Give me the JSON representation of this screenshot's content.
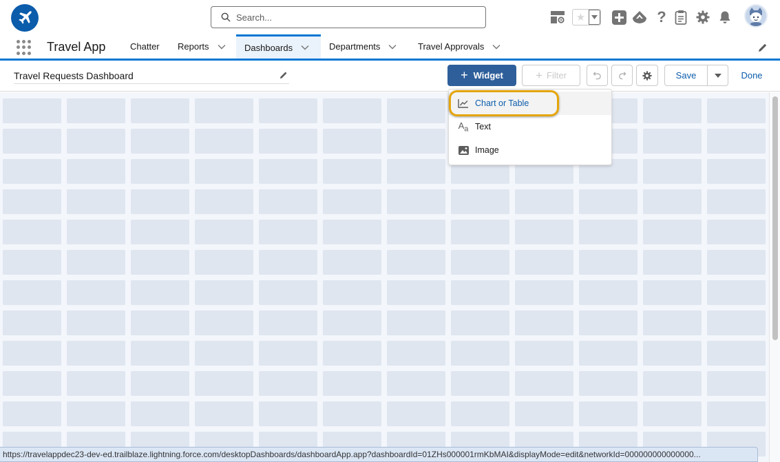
{
  "global_header": {
    "logo_icon": "airplane-icon",
    "search": {
      "placeholder": "Search...",
      "value": ""
    },
    "icons": [
      "setup-assistant-icon",
      "favorite-star-icon",
      "favorites-dropdown-icon",
      "global-actions-plus-icon",
      "trailhead-icon",
      "help-icon",
      "clipboard-icon",
      "setup-gear-icon",
      "notifications-bell-icon",
      "user-avatar-icon"
    ]
  },
  "nav": {
    "app_name": "Travel App",
    "items": [
      {
        "label": "Chatter",
        "has_menu": false,
        "active": false
      },
      {
        "label": "Reports",
        "has_menu": true,
        "active": false
      },
      {
        "label": "Dashboards",
        "has_menu": true,
        "active": true
      },
      {
        "label": "Departments",
        "has_menu": true,
        "active": false
      },
      {
        "label": "Travel Approvals",
        "has_menu": true,
        "active": false
      }
    ],
    "accent_color": "#0176d3"
  },
  "toolbar": {
    "dashboard_title": "Travel Requests Dashboard",
    "widget_label": "Widget",
    "filter_label": "Filter",
    "save_label": "Save",
    "done_label": "Done",
    "primary_color": "#2e5f9a"
  },
  "widget_menu": {
    "items": [
      {
        "label": "Chart or Table",
        "icon": "line-chart-icon",
        "highlighted": true
      },
      {
        "label": "Text",
        "icon": "text-format-icon",
        "highlighted": false
      },
      {
        "label": "Image",
        "icon": "image-icon",
        "highlighted": false
      }
    ],
    "highlight_color": "#e5a50a"
  },
  "canvas": {
    "columns": 12,
    "rows": 12
  },
  "status_bar": {
    "url": "https://travelappdec23-dev-ed.trailblaze.lightning.force.com/desktopDashboards/dashboardApp.app?dashboardId=01ZHs000001rmKbMAI&displayMode=edit&networkId=000000000000000..."
  }
}
